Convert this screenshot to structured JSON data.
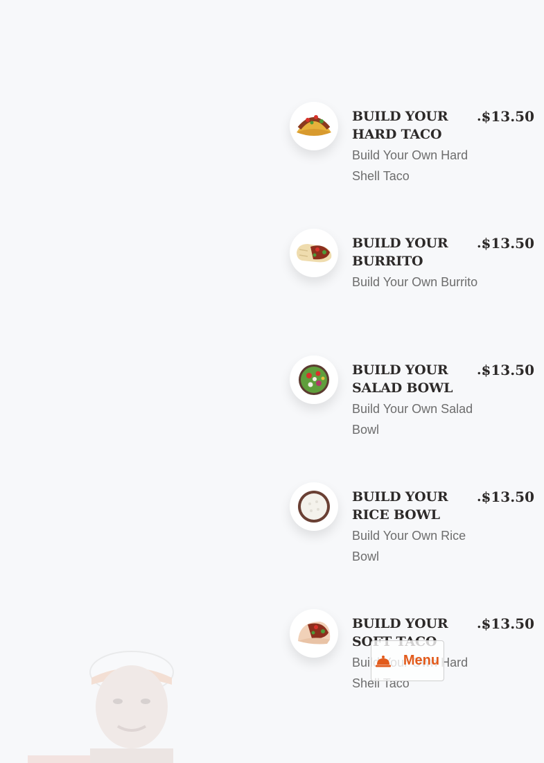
{
  "items": [
    {
      "title": "BUILD YOUR HARD TACO",
      "description": "Build Your Own Hard Shell Taco",
      "dots": "..",
      "price": "$13.50",
      "icon": "hard-taco-icon"
    },
    {
      "title": "BUILD YOUR BURRITO",
      "description": "Build Your Own Burrito",
      "dots": "..",
      "price": "$13.50",
      "icon": "burrito-icon"
    },
    {
      "title": "BUILD YOUR SALAD BOWL",
      "description": "Build Your Own Salad Bowl",
      "dots": "..",
      "price": "$13.50",
      "icon": "salad-bowl-icon"
    },
    {
      "title": "BUILD YOUR RICE BOWL",
      "description": "Build Your Own Rice Bowl",
      "dots": "..",
      "price": "$13.50",
      "icon": "rice-bowl-icon"
    },
    {
      "title": "BUILD YOUR SOFT TACO",
      "description": "Build Your Own Hard Shell Taco",
      "dots": "..",
      "price": "$13.50",
      "icon": "soft-taco-icon"
    }
  ],
  "menu_button": {
    "label": "Menu",
    "icon": "service-bell-icon"
  },
  "colors": {
    "accent": "#e25b1c",
    "title": "#2d2a29",
    "description": "#6d6d6d",
    "background": "#f7f8fa"
  }
}
